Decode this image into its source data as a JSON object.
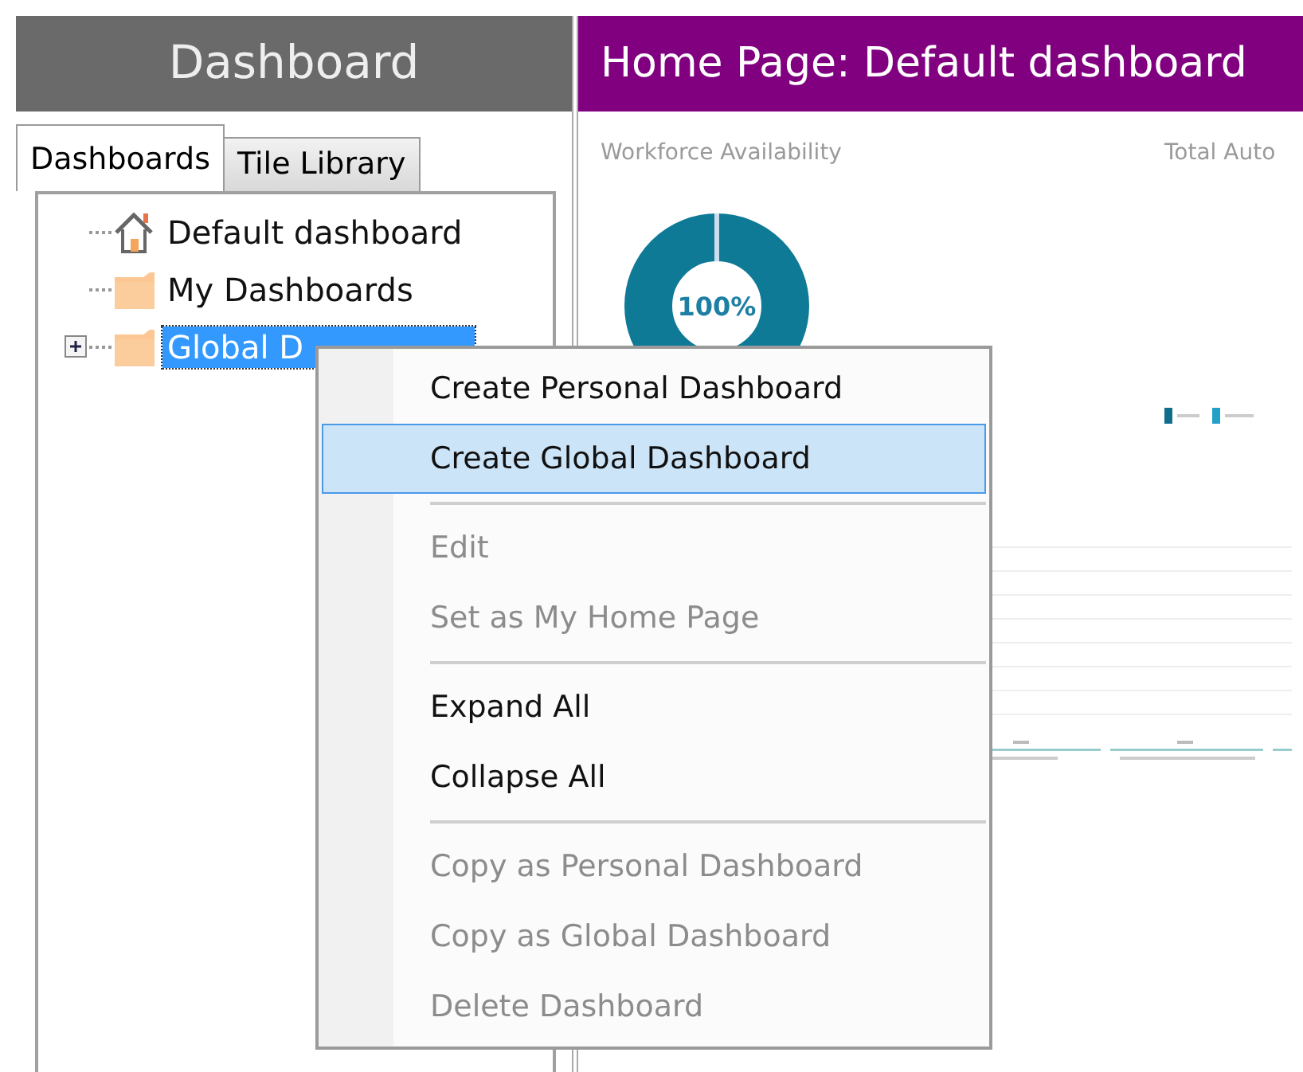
{
  "left_panel": {
    "title": "Dashboard",
    "tabs": [
      {
        "label": "Dashboards",
        "selected": true
      },
      {
        "label": "Tile Library",
        "selected": false
      }
    ],
    "tree": [
      {
        "label": "Default dashboard",
        "kind": "home",
        "selected": false
      },
      {
        "label": "My Dashboards",
        "kind": "folder",
        "selected": false
      },
      {
        "label": "Global D",
        "kind": "folder",
        "selected": true,
        "expanded": false
      }
    ]
  },
  "preview": {
    "title": "Home Page: Default dashboard",
    "tiles": [
      {
        "title": "Workforce Availability",
        "kind": "donut",
        "value": "100%"
      },
      {
        "title": "Total Auto",
        "kind": "bars"
      }
    ]
  },
  "context_menu": [
    {
      "kind": "item",
      "label": "Create Personal Dashboard",
      "disabled": false,
      "selected": false
    },
    {
      "kind": "item",
      "label": "Create Global Dashboard",
      "disabled": false,
      "selected": true
    },
    {
      "kind": "separator"
    },
    {
      "kind": "item",
      "label": "Edit",
      "disabled": true,
      "selected": false
    },
    {
      "kind": "item",
      "label": "Set as My Home Page",
      "disabled": true,
      "selected": false
    },
    {
      "kind": "separator"
    },
    {
      "kind": "item",
      "label": "Expand All",
      "disabled": false,
      "selected": false
    },
    {
      "kind": "item",
      "label": "Collapse All",
      "disabled": false,
      "selected": false
    },
    {
      "kind": "separator"
    },
    {
      "kind": "item",
      "label": "Copy as Personal Dashboard",
      "disabled": true,
      "selected": false
    },
    {
      "kind": "item",
      "label": "Copy as Global Dashboard",
      "disabled": true,
      "selected": false
    },
    {
      "kind": "item",
      "label": "Delete Dashboard",
      "disabled": true,
      "selected": false
    }
  ]
}
